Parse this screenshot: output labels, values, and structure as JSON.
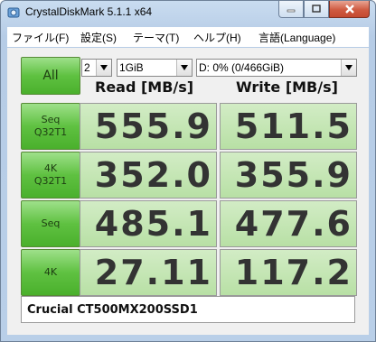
{
  "window": {
    "title": "CrystalDiskMark 5.1.1 x64"
  },
  "menu": [
    "ファイル(F)",
    "設定(S)",
    "テーマ(T)",
    "ヘルプ(H)",
    "言語(Language)"
  ],
  "controls": {
    "all_label": "All",
    "count_value": "2",
    "size_value": "1GiB",
    "drive_value": "D: 0% (0/466GiB)"
  },
  "headers": {
    "read": "Read [MB/s]",
    "write": "Write [MB/s]"
  },
  "tests": [
    {
      "label_line1": "Seq",
      "label_line2": "Q32T1",
      "read": "555.9",
      "write": "511.5",
      "read_fill": 1.0,
      "write_fill": 1.0
    },
    {
      "label_line1": "4K",
      "label_line2": "Q32T1",
      "read": "352.0",
      "write": "355.9",
      "read_fill": 1.0,
      "write_fill": 1.0
    },
    {
      "label_line1": "Seq",
      "label_line2": "",
      "read": "485.1",
      "write": "477.6",
      "read_fill": 1.0,
      "write_fill": 1.0
    },
    {
      "label_line1": "4K",
      "label_line2": "",
      "read": "27.11",
      "write": "117.2",
      "read_fill": 1.0,
      "write_fill": 1.0
    }
  ],
  "comment": "Crucial CT500MX200SSD1"
}
